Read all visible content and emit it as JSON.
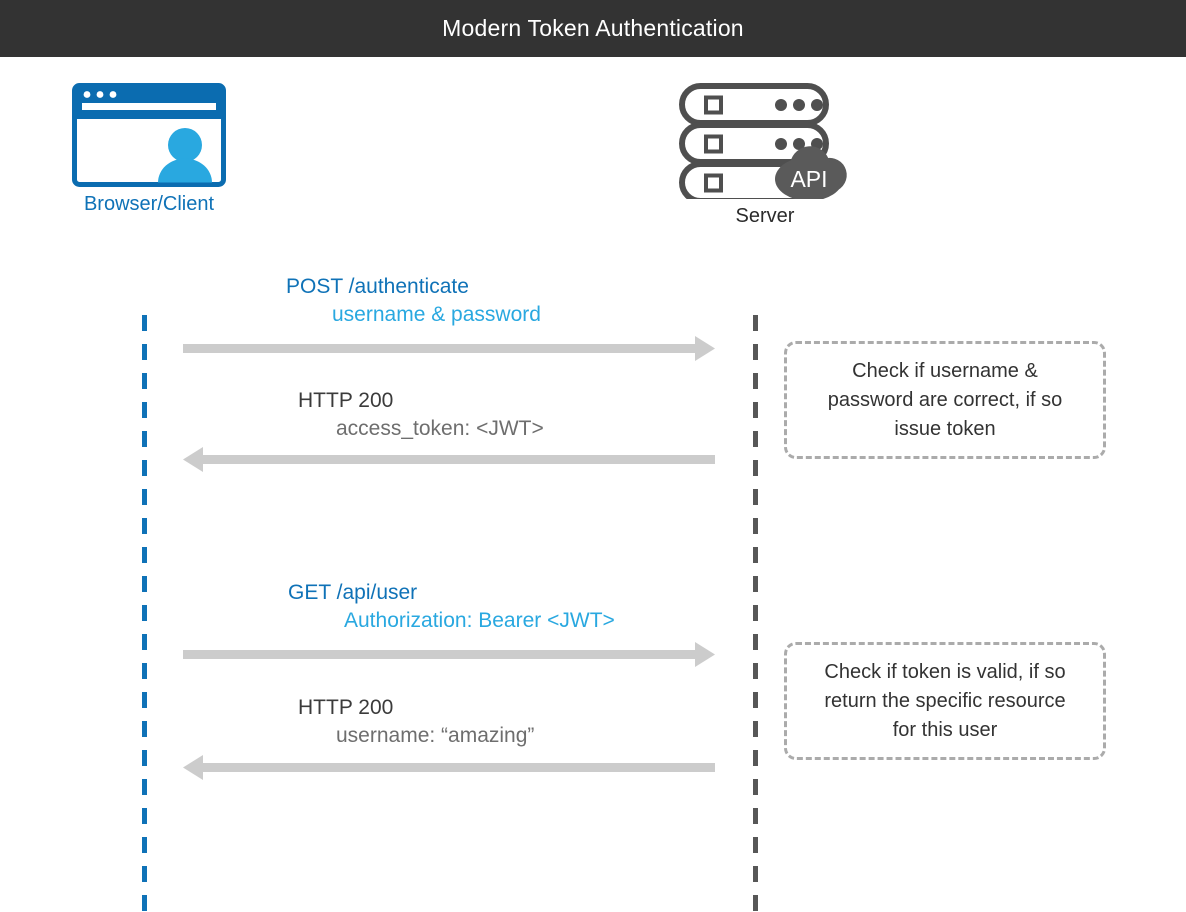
{
  "header": {
    "title": "Modern Token Authentication",
    "background": "#333333",
    "text_color": "#ffffff"
  },
  "colors": {
    "brand_blue": "#0f72b7",
    "light_blue": "#29a8e0",
    "arrow_gray": "#cccccc",
    "note_border": "#ababab",
    "server_gray": "#575757",
    "text_dark": "#3b3b3b",
    "text_mid": "#6e6e6e"
  },
  "actors": [
    {
      "id": "client",
      "label": "Browser/Client",
      "icon": "browser-window-with-user-icon",
      "label_color": "#0f72b7"
    },
    {
      "id": "server",
      "label": "Server",
      "icon": "server-rack-with-api-cloud-icon",
      "label_color": "#2b2b2b",
      "cloud_label": "API"
    }
  ],
  "messages": [
    {
      "id": "post-authenticate",
      "direction": "request",
      "line1": "POST /authenticate",
      "line2": "username & password"
    },
    {
      "id": "auth-response",
      "direction": "response",
      "line1": "HTTP 200",
      "line2": "access_token: <JWT>"
    },
    {
      "id": "get-api-user",
      "direction": "request",
      "line1": "GET /api/user",
      "line2": "Authorization: Bearer <JWT>"
    },
    {
      "id": "user-response",
      "direction": "response",
      "line1": "HTTP 200",
      "line2": "username: “amazing”"
    }
  ],
  "notes": [
    {
      "id": "note-verify-credentials",
      "line1": "Check if username &",
      "line2": "password are correct, if so",
      "line3": "issue token"
    },
    {
      "id": "note-verify-token",
      "line1": "Check if token is valid, if so",
      "line2": "return the specific resource",
      "line3": "for this user"
    }
  ]
}
